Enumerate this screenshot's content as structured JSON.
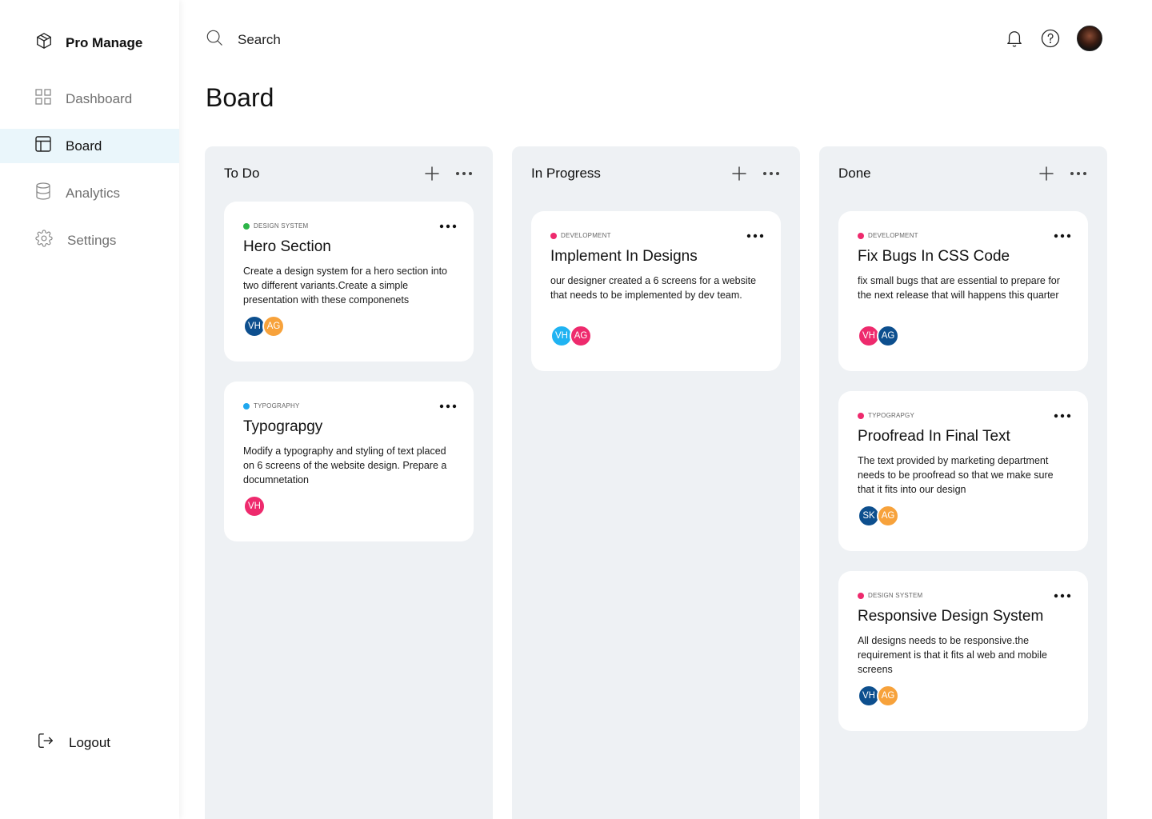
{
  "app": {
    "name": "Pro Manage"
  },
  "sidebar": {
    "items": [
      {
        "label": "Dashboard",
        "icon": "grid-icon"
      },
      {
        "label": "Board",
        "icon": "layout-icon",
        "active": true
      },
      {
        "label": "Analytics",
        "icon": "database-icon"
      },
      {
        "label": "Settings",
        "icon": "gear-icon"
      }
    ],
    "logout_label": "Logout"
  },
  "header": {
    "search_placeholder": "Search"
  },
  "page": {
    "title": "Board"
  },
  "colors": {
    "active_nav_bg": "#eaf6fb",
    "column_bg": "#eef1f4",
    "tag_green": "#2db548",
    "tag_blue": "#1fa7ee",
    "tag_pink": "#ee2a6d",
    "avatar_navy": "#0d4f8e",
    "avatar_orange": "#f7a23b",
    "avatar_cyan": "#20b3f2",
    "avatar_pink": "#ee2a6d"
  },
  "columns": [
    {
      "title": "To Do",
      "cards": [
        {
          "tag": "DESIGN SYSTEM",
          "tag_color": "#2db548",
          "title": "Hero Section",
          "description": "Create a design system for a hero section into two different variants.Create a simple presentation with these componenets",
          "assignees": [
            {
              "initials": "VH",
              "color": "#0d4f8e"
            },
            {
              "initials": "AG",
              "color": "#f7a23b"
            }
          ]
        },
        {
          "tag": "TYPOGRAPHY",
          "tag_color": "#1fa7ee",
          "title": "Typograpgy",
          "description": "Modify a typography and styling of text placed on  6 screens of the website design. Prepare a documnetation",
          "assignees": [
            {
              "initials": "VH",
              "color": "#ee2a6d"
            }
          ]
        }
      ]
    },
    {
      "title": "In Progress",
      "cards": [
        {
          "tag": "DEVELOPMENT",
          "tag_color": "#ee2a6d",
          "title": "Implement In Designs",
          "description": "our designer created a 6 screens for a website that needs to be implemented by dev team.",
          "assignees": [
            {
              "initials": "VH",
              "color": "#20b3f2"
            },
            {
              "initials": "AG",
              "color": "#ee2a6d"
            }
          ]
        }
      ]
    },
    {
      "title": "Done",
      "cards": [
        {
          "tag": "DEVELOPMENT",
          "tag_color": "#ee2a6d",
          "title": "Fix Bugs In CSS Code",
          "description": "fix small bugs that are essential to prepare for the next release that will happens this quarter",
          "assignees": [
            {
              "initials": "VH",
              "color": "#ee2a6d"
            },
            {
              "initials": "AG",
              "color": "#0d4f8e"
            }
          ]
        },
        {
          "tag": "TYPOGRAPGY",
          "tag_color": "#ee2a6d",
          "title": "Proofread In Final Text",
          "description": "The text provided by marketing department needs to be proofread so that we make sure that it fits into our design",
          "assignees": [
            {
              "initials": "SK",
              "color": "#0d4f8e"
            },
            {
              "initials": "AG",
              "color": "#f7a23b"
            }
          ]
        },
        {
          "tag": "DESIGN SYSTEM",
          "tag_color": "#ee2a6d",
          "title": "Responsive Design System",
          "description": "All designs needs to be responsive.the requirement is that it fits al web and mobile screens",
          "assignees": [
            {
              "initials": "VH",
              "color": "#0d4f8e"
            },
            {
              "initials": "AG",
              "color": "#f7a23b"
            }
          ]
        }
      ]
    }
  ]
}
